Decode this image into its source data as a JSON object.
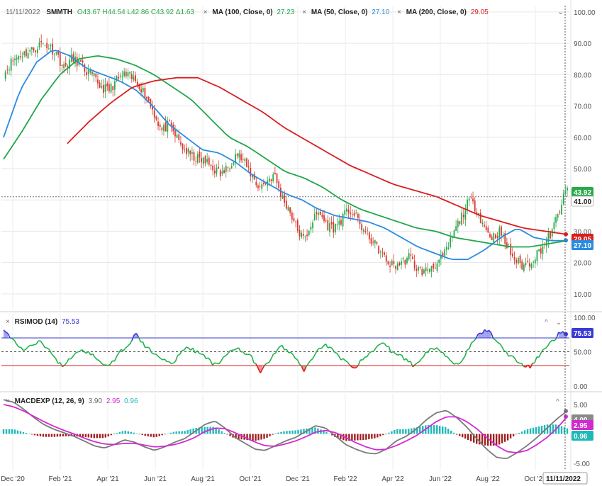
{
  "toolbar": {
    "date": "11/11/2022",
    "symbol": "SMMTH",
    "open": "O43.67",
    "high": "H44.54",
    "low": "L42.86",
    "close": "C43.92",
    "change": "Δ1.63"
  },
  "colors": {
    "up": "#2aa84a",
    "down": "#d9372b",
    "ma100": "#22a64a",
    "ma50": "#2a8ce0",
    "ma200": "#d91e1e",
    "rsi": "#22b14c",
    "rsi_fill_hi": "#3a3ad6",
    "rsi_fill_lo": "#d81e1e",
    "macd": "#7a7a7a",
    "signal": "#d12ad1",
    "hist_pos": "#1fb8b8",
    "hist_neg": "#a02020"
  },
  "legend": {
    "ma100": {
      "label": "MA (100, Close, 0)",
      "value": "27.23"
    },
    "ma50": {
      "label": "MA (50, Close, 0)",
      "value": "27.10"
    },
    "ma200": {
      "label": "MA (200, Close, 0)",
      "value": "29.05"
    },
    "rsi": {
      "label": "RSIMOD (14)",
      "value": "75.53"
    },
    "macd": {
      "label": "MACDEXP (12, 26, 9)",
      "value": "3.90",
      "signal": "2.95",
      "hist": "0.96"
    }
  },
  "badges": {
    "price_last": "43.92",
    "crosshair_price": "41.00",
    "ma200": "29.05",
    "ma50": "27.10",
    "rsi": "75.53",
    "macd": "4.00",
    "signal": "2.95",
    "hist": "0.96",
    "crosshair_date": "11/11/2022"
  },
  "chart_data": [
    {
      "type": "candlestick",
      "title": "SMMTH",
      "x_tick_labels": [
        "Dec '20",
        "Feb '21",
        "Apr '21",
        "Jun '21",
        "Aug '21",
        "Oct '21",
        "Dec '21",
        "Feb '22",
        "Apr '22",
        "Jun '22",
        "Aug '22",
        "Oct '22"
      ],
      "y_tick_labels": [
        "100.00",
        "90.00",
        "80.00",
        "70.00",
        "60.00",
        "50.00",
        "40.00",
        "30.00",
        "20.00",
        "10.00"
      ],
      "ylim": [
        5,
        102
      ],
      "last_close": 43.92,
      "closes_weekly": [
        80,
        84,
        86,
        87,
        88,
        90,
        89,
        87,
        82,
        85,
        84,
        81,
        79,
        76,
        75,
        78,
        80,
        79,
        77,
        73,
        68,
        62,
        64,
        60,
        56,
        54,
        53,
        52,
        50,
        48,
        51,
        55,
        52,
        48,
        44,
        46,
        48,
        41,
        37,
        31,
        27,
        33,
        36,
        32,
        31,
        34,
        37,
        34,
        30,
        27,
        24,
        20,
        19,
        20,
        22,
        18,
        17,
        19,
        20,
        24,
        30,
        35,
        40,
        37,
        31,
        28,
        30,
        25,
        21,
        19,
        20,
        23,
        26,
        30,
        37,
        44
      ],
      "series": [
        {
          "name": "MA (50, Close, 0)",
          "last": 27.1,
          "values": [
            60,
            75,
            84,
            88,
            86,
            82,
            80,
            78,
            75,
            70,
            64,
            60,
            56,
            55,
            52,
            48,
            45,
            42,
            40,
            37,
            35,
            34,
            33,
            31,
            28,
            25,
            23,
            21,
            21,
            24,
            28,
            31,
            28,
            27,
            27
          ]
        },
        {
          "name": "MA (100, Close, 0)",
          "last": 27.23,
          "values": [
            53,
            62,
            72,
            80,
            85,
            86,
            85,
            83,
            80,
            76,
            72,
            66,
            60,
            57,
            53,
            49,
            47,
            44,
            40,
            37,
            35,
            33,
            31,
            30,
            28,
            27,
            26,
            25,
            25,
            26,
            27
          ]
        },
        {
          "name": "MA (200, Close, 0)",
          "last": 29.05,
          "values": [
            58,
            65,
            71,
            76,
            78,
            79,
            79,
            76,
            72,
            68,
            63,
            59,
            55,
            51,
            48,
            45,
            43,
            41,
            38,
            35,
            33,
            31,
            30,
            29
          ]
        }
      ]
    },
    {
      "type": "line",
      "title": "RSIMOD (14)",
      "y_tick_labels": [
        "100.00",
        "50.00",
        "0.00"
      ],
      "ylim": [
        -5,
        105
      ],
      "levels": [
        70,
        50,
        30
      ],
      "last": 75.53,
      "values": [
        82,
        71,
        58,
        52,
        60,
        66,
        54,
        42,
        28,
        40,
        48,
        52,
        46,
        40,
        28,
        35,
        50,
        60,
        76,
        62,
        52,
        46,
        38,
        30,
        48,
        58,
        52,
        46,
        38,
        30,
        40,
        52,
        56,
        48,
        40,
        20,
        32,
        48,
        58,
        50,
        40,
        22,
        38,
        55,
        60,
        52,
        40,
        34,
        28,
        38,
        48,
        56,
        64,
        50,
        46,
        38,
        30,
        40,
        52,
        56,
        48,
        40,
        30,
        44,
        62,
        76,
        82,
        70,
        58,
        46,
        38,
        30,
        28,
        42,
        56,
        66,
        78,
        75
      ]
    },
    {
      "type": "line",
      "title": "MACDEXP (12, 26, 9)",
      "y_tick_labels": [
        "5.00",
        "0.00",
        "-5.00"
      ],
      "ylim": [
        -6.2,
        6.8
      ],
      "series": [
        {
          "name": "MACD",
          "last": 3.9,
          "values": [
            5.8,
            5.4,
            4.2,
            2.8,
            1.6,
            0.8,
            0.2,
            -0.4,
            -1.2,
            -2.0,
            -2.4,
            -1.8,
            -1.0,
            -1.4,
            -2.2,
            -2.8,
            -2.2,
            -1.4,
            -0.8,
            0.4,
            1.6,
            2.2,
            1.0,
            -0.6,
            -1.6,
            -2.6,
            -2.8,
            -2.0,
            -1.2,
            -0.6,
            0.4,
            1.4,
            1.0,
            -0.4,
            -1.8,
            -2.6,
            -3.2,
            -3.4,
            -2.6,
            -1.2,
            -0.4,
            0.8,
            2.4,
            3.6,
            4.0,
            2.8,
            1.2,
            -0.8,
            -2.6,
            -4.0,
            -4.2,
            -3.2,
            -2.0,
            -0.6,
            1.0,
            2.6,
            3.9
          ]
        },
        {
          "name": "Signal",
          "last": 2.95,
          "values": [
            5.0,
            4.6,
            3.9,
            3.0,
            2.1,
            1.3,
            0.6,
            0.0,
            -0.7,
            -1.3,
            -1.7,
            -1.8,
            -1.6,
            -1.6,
            -1.9,
            -2.2,
            -2.1,
            -1.8,
            -1.3,
            -0.6,
            0.4,
            1.0,
            0.9,
            0.2,
            -0.6,
            -1.4,
            -2.0,
            -2.1,
            -1.7,
            -1.2,
            -0.5,
            0.3,
            0.6,
            0.2,
            -0.6,
            -1.5,
            -2.2,
            -2.7,
            -2.6,
            -2.0,
            -1.2,
            -0.3,
            0.9,
            2.1,
            2.9,
            2.9,
            2.1,
            0.9,
            -0.6,
            -2.0,
            -3.0,
            -3.2,
            -2.8,
            -1.8,
            -0.6,
            1.0,
            2.95
          ]
        },
        {
          "name": "Histogram",
          "last": 0.96
        }
      ]
    }
  ]
}
